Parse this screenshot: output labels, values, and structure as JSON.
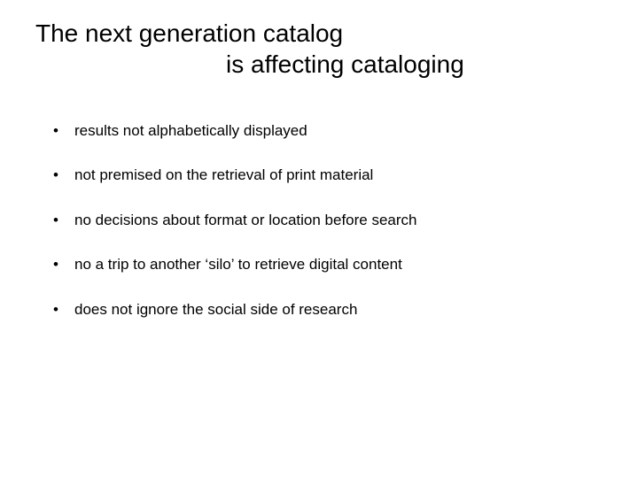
{
  "title": {
    "line1": "The next generation catalog",
    "line2": "is affecting cataloging"
  },
  "bullets": [
    "results not alphabetically displayed",
    "not premised on the retrieval of print material",
    "no decisions about format or location before search",
    "no a trip to another ‘silo’ to retrieve digital content",
    "does not ignore the social side of research"
  ]
}
